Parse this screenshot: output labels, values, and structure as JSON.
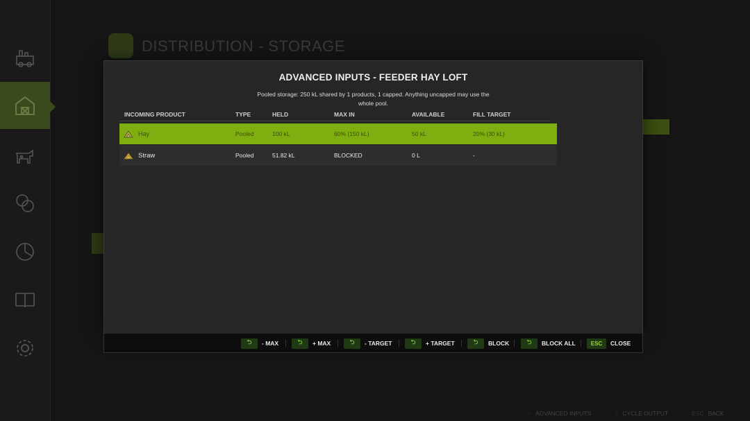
{
  "background": {
    "title": "DISTRIBUTION - STORAGE",
    "hints": [
      {
        "key": "○",
        "label": "ADVANCED INPUTS"
      },
      {
        "key": "○",
        "label": "CYCLE OUTPUT"
      },
      {
        "key": "ESC",
        "label": "BACK"
      }
    ]
  },
  "sidebar": {
    "items": [
      {
        "icon": "production-icon"
      },
      {
        "icon": "barn-icon",
        "active": true
      },
      {
        "icon": "animals-icon"
      },
      {
        "icon": "finance-icon"
      },
      {
        "icon": "statistics-icon"
      },
      {
        "icon": "help-book-icon"
      },
      {
        "icon": "settings-icon"
      }
    ]
  },
  "modal": {
    "title": "ADVANCED INPUTS - FEEDER HAY LOFT",
    "subtitle": "Pooled storage: 250 kL shared by 1 products, 1 capped. Anything uncapped may use the whole pool.",
    "columns": [
      "INCOMING PRODUCT",
      "TYPE",
      "HELD",
      "MAX IN",
      "AVAILABLE",
      "FILL TARGET"
    ],
    "rows": [
      {
        "product": "Hay",
        "type": "Pooled",
        "held": "100 kL",
        "max_in": "60%  (150 kL)",
        "available": "50 kL",
        "fill_target": "20%  (30 kL)",
        "selected": true
      },
      {
        "product": "Straw",
        "type": "Pooled",
        "held": "51.82 kL",
        "max_in": "BLOCKED",
        "available": "0 L",
        "fill_target": "-",
        "selected": false
      }
    ]
  },
  "actions": [
    {
      "key": "⮌",
      "label": "- MAX"
    },
    {
      "key": "⮌",
      "label": "+ MAX"
    },
    {
      "key": "⮌",
      "label": "- TARGET"
    },
    {
      "key": "⮌",
      "label": "+ TARGET"
    },
    {
      "key": "⮌",
      "label": "BLOCK"
    },
    {
      "key": "⮌",
      "label": "BLOCK ALL"
    },
    {
      "key": "ESC",
      "label": "CLOSE"
    }
  ],
  "colors": {
    "accent": "#7fae10",
    "key_bg": "#1f3a14",
    "modal_bg": "#262626"
  }
}
